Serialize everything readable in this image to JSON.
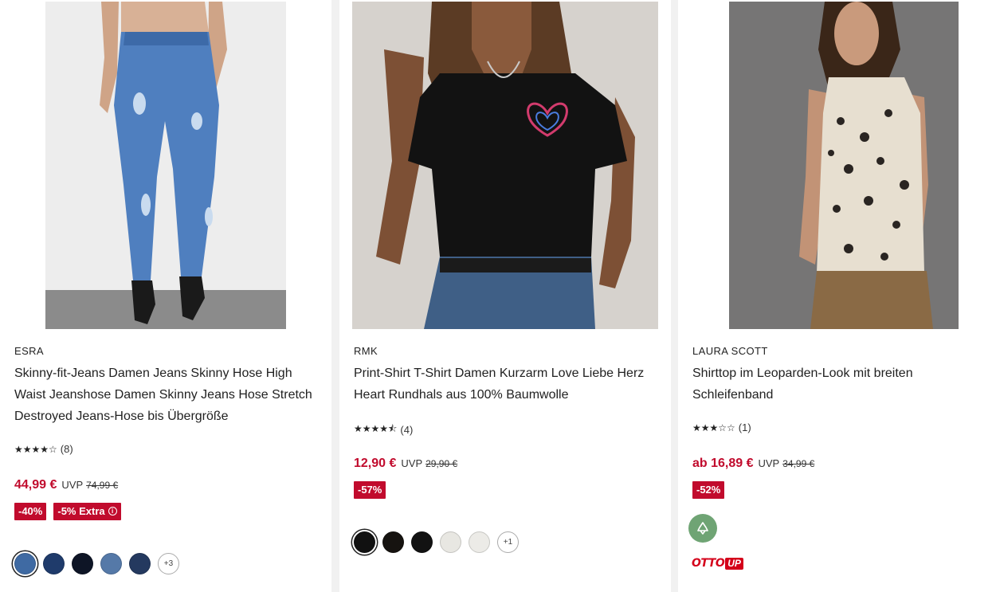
{
  "products": [
    {
      "brand": "ESRA",
      "title": "Skinny-fit-Jeans Damen Jeans Skinny Hose High Waist Jeanshose Damen Skinny Jeans Hose Stretch Destroyed Jeans-Hose bis Übergröße",
      "rating_stars": "★★★★☆",
      "rating_value": 4,
      "rating_count": "(8)",
      "price": "44,99 €",
      "uvp_label": "UVP",
      "old_price": "74,99 €",
      "badges": [
        "-40%",
        "-5% Extra"
      ],
      "swatch_colors": [
        "#3f6aa3",
        "#1f3b6b",
        "#0e1526",
        "#5579a8",
        "#24395f"
      ],
      "more_colors": "+3"
    },
    {
      "brand": "RMK",
      "title": "Print-Shirt T-Shirt Damen Kurzarm Love Liebe Herz Heart Rundhals aus 100% Baumwolle",
      "rating_stars": "★★★★⯪",
      "rating_value": 4.5,
      "rating_count": "(4)",
      "price": "12,90 €",
      "uvp_label": "UVP",
      "old_price": "29,90 €",
      "badges": [
        "-57%"
      ],
      "swatch_colors": [
        "#111111",
        "#161310",
        "#121212",
        "#e8e7e2",
        "#ecebe7"
      ],
      "more_colors": "+1"
    },
    {
      "brand": "LAURA SCOTT",
      "title": "Shirttop im Leoparden-Look mit breiten Schleifenband",
      "rating_stars": "★★★☆☆",
      "rating_value": 3,
      "rating_count": "(1)",
      "price": "ab 16,89 €",
      "uvp_label": "UVP",
      "old_price": "34,99 €",
      "badges": [
        "-52%"
      ],
      "eco_icon": "recycle-icon",
      "otto_up_logo": "OTTO UP"
    }
  ],
  "colors": {
    "sale_red": "#c10b2d",
    "eco_green": "#6fa474",
    "otto_red": "#d4001a"
  }
}
